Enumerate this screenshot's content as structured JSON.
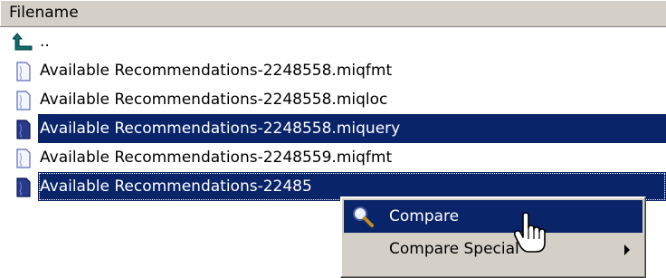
{
  "header": {
    "column_filename": "Filename"
  },
  "rows": [
    {
      "label": "..",
      "icon": "parent-folder-up-arrow-icon",
      "selected": false
    },
    {
      "label": "Available Recommendations-2248558.miqfmt",
      "icon": "document-icon",
      "selected": false
    },
    {
      "label": "Available Recommendations-2248558.miqloc",
      "icon": "document-icon",
      "selected": false
    },
    {
      "label": "Available Recommendations-2248558.miquery",
      "icon": "document-icon",
      "selected": true
    },
    {
      "label": "Available Recommendations-2248559.miqfmt",
      "icon": "document-icon",
      "selected": false
    },
    {
      "label": "Available Recommendations-22485",
      "icon": "document-icon",
      "selected": true
    }
  ],
  "context_menu": {
    "items": [
      {
        "label": "Compare",
        "icon": "magnifier-icon",
        "highlighted": true
      },
      {
        "label": "Compare Special",
        "icon": "",
        "has_submenu": true
      }
    ]
  },
  "colors": {
    "selection": "#0a246a",
    "chrome": "#d4d0c8",
    "icon_teal": "#0f6e6e"
  }
}
